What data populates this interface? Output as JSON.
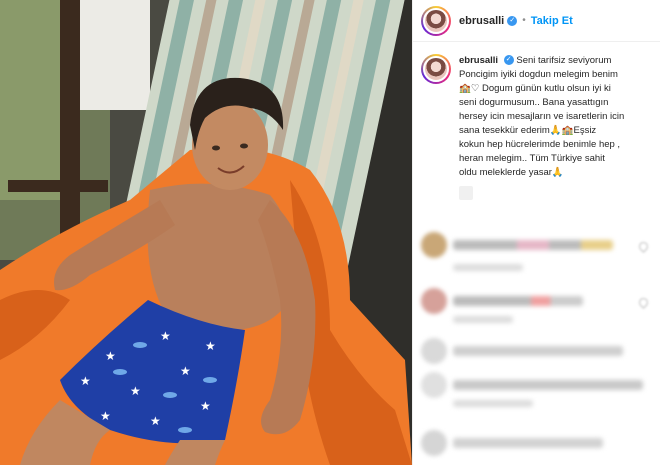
{
  "post": {
    "username": "ebrusalli",
    "follow_label": "Takip Et",
    "separator": "•",
    "verified_mark": "✓"
  },
  "caption": {
    "username": "ebrusalli",
    "line1": "Seni tarifsiz seviyorum",
    "line2": "Poncigim iyiki dogdun melegim benim",
    "line3": "🏫♡ Dogum günün kutlu olsun iyi ki",
    "line4": "seni dogurmusum.. Bana yasattıgın",
    "line5": "hersey icin mesajların ve isaretlerin icin",
    "line6": "sana tesekkür ederim🙏🏫Eşsiz",
    "line7": "kokun hep hücrelerimde benimle hep ,",
    "line8": "heran melegim.. Tüm Türkiye sahit",
    "line9": "oldu meleklerde yasar🙏"
  },
  "colors": {
    "accent": "#0095f6",
    "verified": "#3897f0",
    "towel": "#f07a2a",
    "shorts": "#1f3fa6"
  },
  "icons": [
    "verified-icon",
    "heart-icon"
  ]
}
